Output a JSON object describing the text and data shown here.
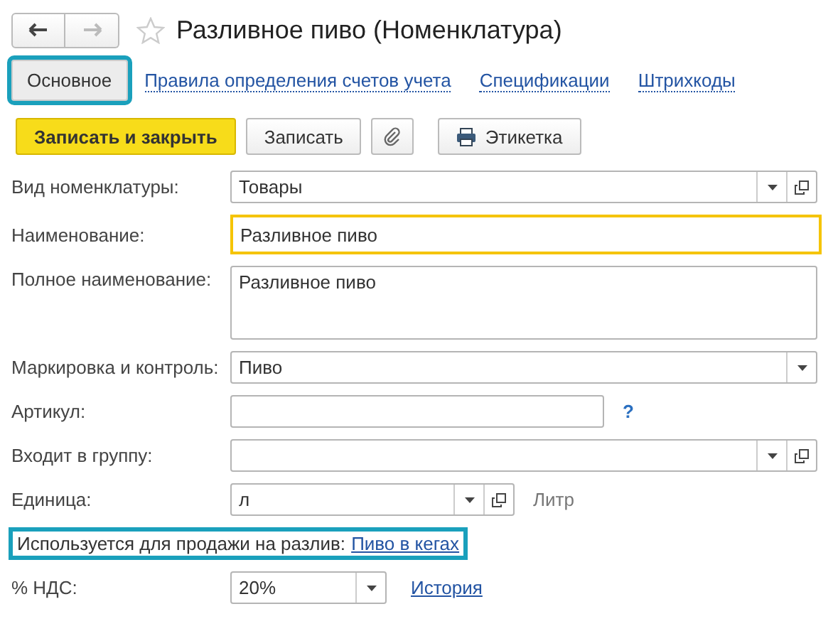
{
  "title": "Разливное пиво (Номенклатура)",
  "favorite": false,
  "tabs": [
    {
      "label": "Основное",
      "selected": true,
      "highlighted": true
    },
    {
      "label": "Правила определения счетов учета",
      "selected": false,
      "highlighted": false
    },
    {
      "label": "Спецификации",
      "selected": false,
      "highlighted": false
    },
    {
      "label": "Штрихкоды",
      "selected": false,
      "highlighted": false
    }
  ],
  "toolbar": [
    {
      "kind": "primary",
      "label": "Записать и закрыть"
    },
    {
      "kind": "plain",
      "label": "Записать"
    },
    {
      "kind": "attach"
    },
    {
      "kind": "print",
      "label": "Этикетка"
    }
  ],
  "fields": [
    {
      "kind": "input",
      "label": "Вид номенклатуры:",
      "value": "Товары",
      "dropdown": true,
      "open": true,
      "focused": false
    },
    {
      "kind": "input",
      "label": "Наименование:",
      "value": "Разливное пиво",
      "focused": true
    },
    {
      "kind": "textarea",
      "label": "Полное наименование:",
      "value": "Разливное пиво",
      "focused": false
    },
    {
      "kind": "input",
      "label": "Маркировка и контроль:",
      "value": "Пиво",
      "dropdown": true,
      "focused": false
    },
    {
      "kind": "input",
      "label": "Артикул:",
      "focused": false,
      "help": "?"
    },
    {
      "kind": "input",
      "label": "Входит в группу:",
      "dropdown": true,
      "open": true,
      "focused": false
    },
    {
      "kind": "input",
      "label": "Единица:",
      "value": "л",
      "dropdown": true,
      "open": true,
      "focused": false,
      "note": "Литр"
    },
    {
      "kind": "info",
      "text": "Используется для продажи на разлив:",
      "link": "Пиво в кегах",
      "highlighted": true
    },
    {
      "kind": "input",
      "label": "% НДС:",
      "value": "20%",
      "dropdown": true,
      "focused": false,
      "link": "История"
    }
  ]
}
